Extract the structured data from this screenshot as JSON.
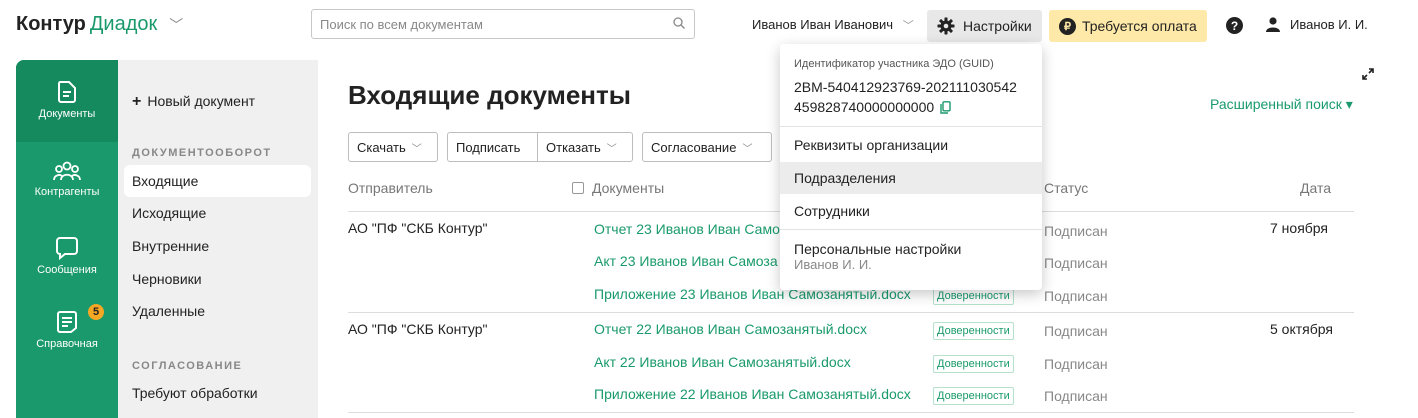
{
  "header": {
    "logo_main": "Контур",
    "logo_brand": "Диадок",
    "search_placeholder": "Поиск по всем документам",
    "user_name": "Иванов Иван Иванович",
    "settings_label": "Настройки",
    "payment_label": "Требуется оплата",
    "payment_icon": "₽",
    "help_icon": "?",
    "profile_name": "Иванов И. И."
  },
  "rail": {
    "items": [
      {
        "label": "Документы",
        "icon": "document-icon"
      },
      {
        "label": "Контрагенты",
        "icon": "contacts-icon"
      },
      {
        "label": "Сообщения",
        "icon": "message-icon"
      },
      {
        "label": "Справочная",
        "icon": "reference-icon",
        "badge": "5"
      }
    ]
  },
  "subnav": {
    "new_document": "Новый документ",
    "section_workflow": "ДОКУМЕНТООБОРОТ",
    "workflow_items": [
      "Входящие",
      "Исходящие",
      "Внутренние",
      "Черновики",
      "Удаленные"
    ],
    "section_approval": "СОГЛАСОВАНИЕ",
    "approval_items": [
      "Требуют обработки"
    ]
  },
  "main": {
    "title": "Входящие документы",
    "advanced_search": "Расширенный поиск ▾",
    "toolbar": {
      "download": "Скачать",
      "sign": "Подписать",
      "reject": "Отказать",
      "approval": "Согласование"
    },
    "columns": {
      "sender": "Отправитель",
      "documents": "Документы",
      "status": "Статус",
      "date": "Дата"
    },
    "groups": [
      {
        "sender": "АО \"ПФ \"СКБ Контур\"",
        "date": "7 ноября",
        "docs": [
          {
            "name": "Отчет 23 Иванов Иван Само",
            "tag": "",
            "status": "Подписан"
          },
          {
            "name": "Акт 23 Иванов Иван Самоза",
            "tag": "",
            "status": "Подписан"
          },
          {
            "name": "Приложение 23 Иванов Иван Самозанятый.docx",
            "tag": "Доверенности",
            "status": "Подписан"
          }
        ]
      },
      {
        "sender": "АО \"ПФ \"СКБ Контур\"",
        "date": "5 октября",
        "docs": [
          {
            "name": "Отчет 22 Иванов Иван Самозанятый.docx",
            "tag": "Доверенности",
            "status": "Подписан"
          },
          {
            "name": "Акт 22 Иванов Иван Самозанятый.docx",
            "tag": "Доверенности",
            "status": "Подписан"
          },
          {
            "name": "Приложение 22 Иванов Иван Самозанятый.docx",
            "tag": "Доверенности",
            "status": "Подписан"
          }
        ]
      }
    ]
  },
  "settings_dropdown": {
    "guid_label": "Идентификатор участника ЭДО (GUID)",
    "guid_line1": "2BM-540412923769-202111030542",
    "guid_line2": "459828740000000000",
    "items": [
      "Реквизиты организации",
      "Подразделения",
      "Сотрудники",
      "Персональные настройки"
    ],
    "personal_sub": "Иванов И. И."
  },
  "colors": {
    "accent": "#1a9a6c",
    "payment_bg": "#ffe9a8",
    "badge": "#f5a623"
  }
}
